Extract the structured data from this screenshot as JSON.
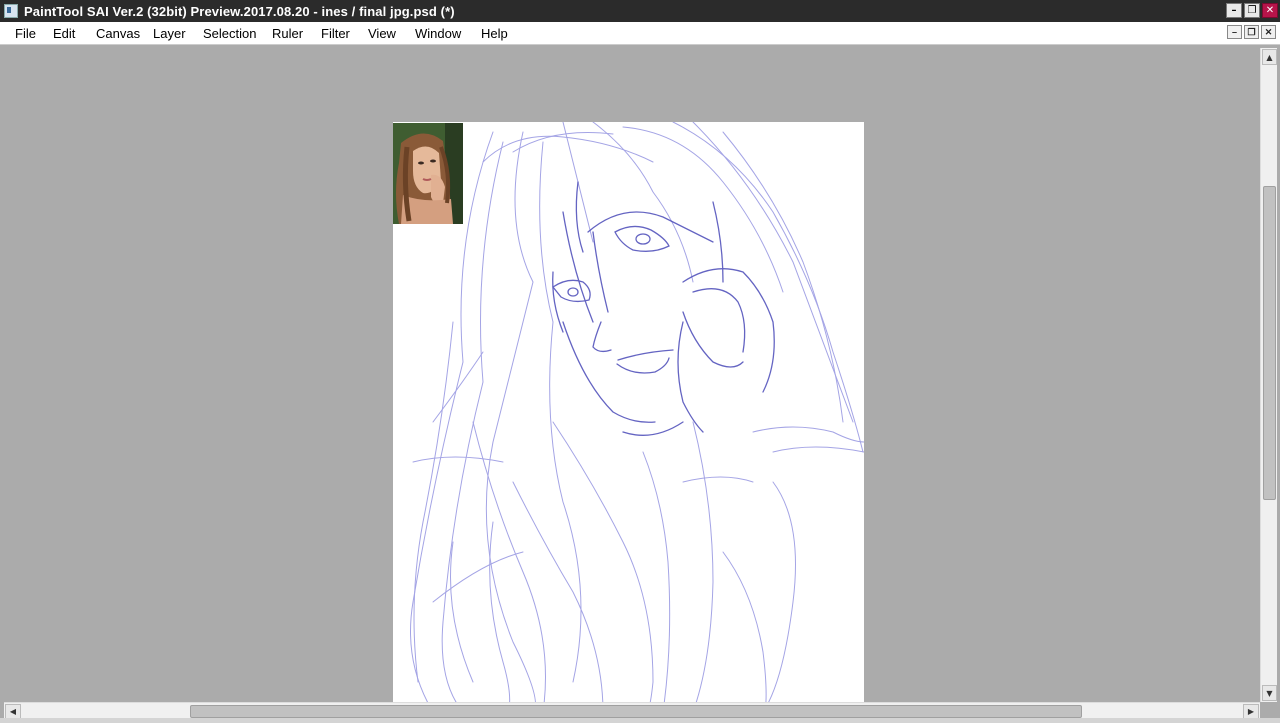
{
  "window": {
    "title": "PaintTool SAI Ver.2 (32bit) Preview.2017.08.20 - ines / final jpg.psd (*)",
    "minimize_glyph": "–",
    "restore_glyph": "❐",
    "close_glyph": "✕"
  },
  "menu": {
    "items": [
      {
        "label": "File"
      },
      {
        "label": "Edit"
      },
      {
        "label": "Canvas"
      },
      {
        "label": "Layer"
      },
      {
        "label": "Selection"
      },
      {
        "label": "Ruler"
      },
      {
        "label": "Filter"
      },
      {
        "label": "View"
      },
      {
        "label": "Window"
      },
      {
        "label": "Help"
      }
    ],
    "mdi_minimize_glyph": "–",
    "mdi_restore_glyph": "❐",
    "mdi_close_glyph": "✕"
  },
  "scrollbars": {
    "up_glyph": "▲",
    "down_glyph": "▼",
    "left_glyph": "◀",
    "right_glyph": "▶"
  },
  "colors": {
    "titlebar": "#2b2b2b",
    "workspace": "#ababab",
    "sketch_stroke": "#5a5ad0",
    "close_button": "#b8144a"
  },
  "icons": {
    "app": "painttool-sai-icon",
    "minimize": "minimize-icon",
    "restore": "restore-icon",
    "close": "close-icon"
  }
}
